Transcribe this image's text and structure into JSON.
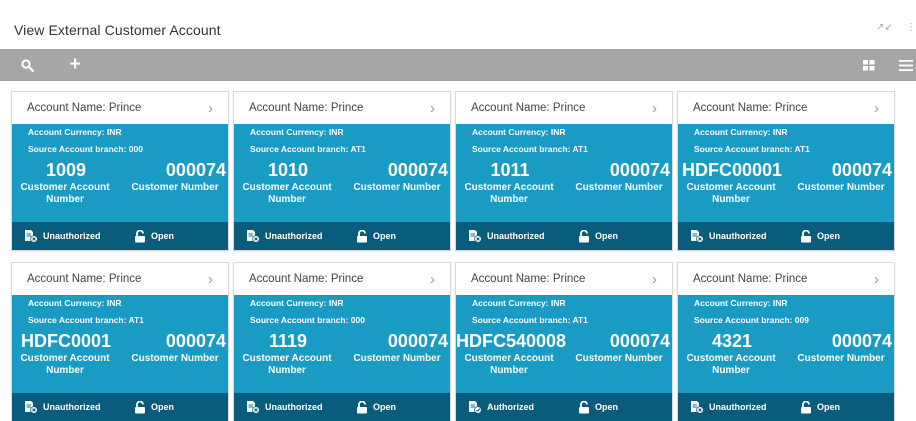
{
  "page": {
    "title": "View External Customer Account"
  },
  "toolbar": {
    "search_icon": "search-icon",
    "add_label": "+",
    "grid_icon": "grid-view-icon",
    "list_icon": "list-view-icon"
  },
  "colors": {
    "toolbar_bg": "#a6a6a6",
    "card_body": "#1a9bc3",
    "card_footer": "#0a5c7d"
  },
  "labels": {
    "account_name": "Account Name:",
    "currency": "Account Currency:",
    "branch": "Source Account branch:",
    "account_number_caption": "Customer Account Number",
    "customer_number_caption": "Customer Number"
  },
  "cards": [
    {
      "name": "Prince",
      "currency": "INR",
      "branch": "000",
      "account_number": "1009",
      "customer_number": "000074",
      "auth_status": "Unauthorized",
      "record_status": "Open"
    },
    {
      "name": "Prince",
      "currency": "INR",
      "branch": "AT1",
      "account_number": "1010",
      "customer_number": "000074",
      "auth_status": "Unauthorized",
      "record_status": "Open"
    },
    {
      "name": "Prince",
      "currency": "INR",
      "branch": "AT1",
      "account_number": "1011",
      "customer_number": "000074",
      "auth_status": "Unauthorized",
      "record_status": "Open"
    },
    {
      "name": "Prince",
      "currency": "INR",
      "branch": "AT1",
      "account_number": "HDFC00001",
      "customer_number": "000074",
      "auth_status": "Unauthorized",
      "record_status": "Open"
    },
    {
      "name": "Prince",
      "currency": "INR",
      "branch": "AT1",
      "account_number": "HDFC0001",
      "customer_number": "000074",
      "auth_status": "Unauthorized",
      "record_status": "Open"
    },
    {
      "name": "Prince",
      "currency": "INR",
      "branch": "000",
      "account_number": "1119",
      "customer_number": "000074",
      "auth_status": "Unauthorized",
      "record_status": "Open"
    },
    {
      "name": "Prince",
      "currency": "INR",
      "branch": "AT1",
      "account_number": "HDFC540008",
      "customer_number": "000074",
      "auth_status": "Authorized",
      "record_status": "Open"
    },
    {
      "name": "Prince",
      "currency": "INR",
      "branch": "009",
      "account_number": "4321",
      "customer_number": "000074",
      "auth_status": "Unauthorized",
      "record_status": "Open"
    }
  ]
}
